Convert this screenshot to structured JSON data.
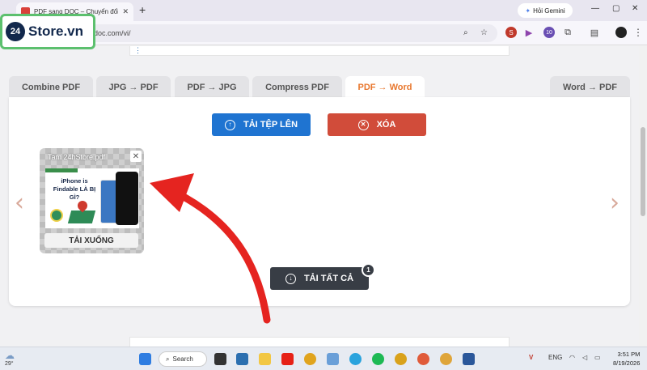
{
  "browser": {
    "tab_title": "PDF sang DOC – Chuyển đổi PDF",
    "tab_close": "✕",
    "new_tab": "+",
    "gemini_label": "Hỏi Gemini",
    "url": "doc.com/vi/",
    "window_controls": [
      "—",
      "▢",
      "✕"
    ],
    "extension_badge": "10"
  },
  "logo": {
    "badge": "24",
    "text": "Store.vn"
  },
  "tool_tabs": [
    {
      "label": "Combine PDF",
      "active": false
    },
    {
      "label": "JPG → PDF",
      "active": false
    },
    {
      "label": "PDF → JPG",
      "active": false
    },
    {
      "label": "Compress PDF",
      "active": false
    },
    {
      "label": "PDF → Word",
      "active": true
    },
    {
      "label": "Word → PDF",
      "active": false
    }
  ],
  "buttons": {
    "upload": "TẢI TỆP LÊN",
    "clear": "XÓA",
    "download_all": "TẢI TẤT CẢ",
    "download_all_count": "1"
  },
  "file_card": {
    "name": "Tam 24hStore.pdf",
    "preview_title": "iPhone is Findable LÀ BỊ GÌ?",
    "download": "TẢI XUỐNG"
  },
  "nav": {
    "prev": "‹",
    "next": "›"
  },
  "taskbar": {
    "weather_temp": "29°",
    "search": "Search",
    "lang": "ENG",
    "time": "3:51 PM",
    "date": "8/19/2026"
  },
  "colors": {
    "upload": "#1f74d1",
    "clear": "#d14c3a",
    "download_all": "#383d45",
    "active_tab": "#e8772e",
    "annotation_arrow": "#e52420",
    "logo_border": "#5cc06e"
  }
}
